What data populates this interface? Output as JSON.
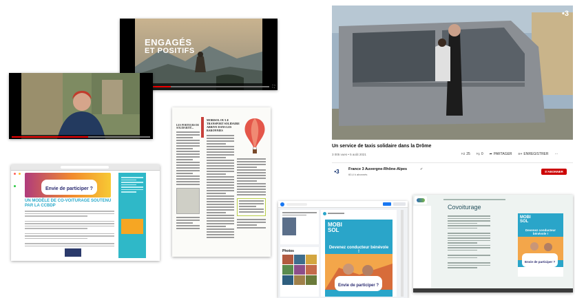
{
  "video_engages": {
    "title_line1": "ENGAGÉS",
    "title_line2": "ET POSITIFS"
  },
  "youtube": {
    "channel_logo": "•3",
    "video_title": "Un service de taxis solidaire dans la Drôme",
    "views_date": "3 005 vues • 5 août 2021",
    "like_count": "25",
    "dislike_count": "0",
    "share_label": "PARTAGER",
    "save_label": "ENREGISTRER",
    "more_label": "···",
    "channel_name": "France 3 Auvergne-Rhône-Alpes",
    "subscribers": "60,4 k abonnés",
    "subscribe_label": "S'ABONNER",
    "accent": "#cc0000"
  },
  "newspaper": {
    "side_heading": "LES PORTEURS DE SOLIDARITÉ...",
    "main_heading": "MOBISOL OU LE TRANSPORT SOLIDAIRE ARRIVE DANS LES BARONNIES"
  },
  "website": {
    "banner_text": "Envie de participer ?",
    "article_title": "UN MODÈLE DE CO-VOITURAGE SOUTENU PAR LA CCBDP",
    "accent": "#29b6c7"
  },
  "facebook": {
    "poster_title": "MOBI SOL",
    "poster_text": "Devenez conducteur bénévole !",
    "poster_cta": "Envie de participer ?",
    "photos_label": "Photos",
    "poster_accent": "#2aa5c9"
  },
  "covoiturage": {
    "title": "Covoiturage",
    "poster_title": "MOBI SOL",
    "poster_text": "Devenez conducteur bénévole !",
    "poster_cta": "Envie de participer ?"
  }
}
